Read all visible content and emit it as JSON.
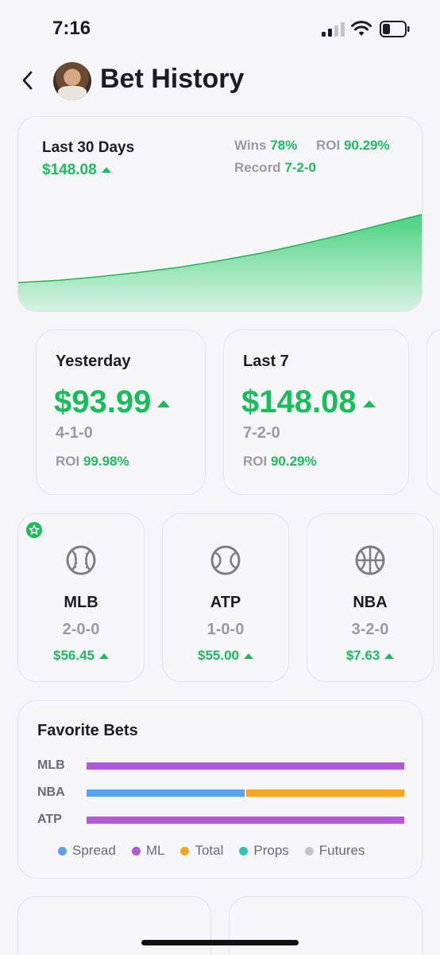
{
  "status_bar": {
    "time": "7:16"
  },
  "header": {
    "title": "Bet History"
  },
  "summary": {
    "label": "Last 30 Days",
    "amount": "$148.08",
    "wins_label": "Wins",
    "wins_value": "78%",
    "roi_label": "ROI",
    "roi_value": "90.29%",
    "record_label": "Record",
    "record_value": "7-2-0"
  },
  "period_cards": [
    {
      "title": "Yesterday",
      "amount": "$93.99",
      "record": "4-1-0",
      "roi_label": "ROI",
      "roi_value": "99.98%"
    },
    {
      "title": "Last 7",
      "amount": "$148.08",
      "record": "7-2-0",
      "roi_label": "ROI",
      "roi_value": "90.29%"
    }
  ],
  "sport_cards": [
    {
      "name": "MLB",
      "record": "2-0-0",
      "amount": "$56.45",
      "icon": "baseball-icon",
      "favorite": true
    },
    {
      "name": "ATP",
      "record": "1-0-0",
      "amount": "$55.00",
      "icon": "tennis-ball-icon",
      "favorite": false
    },
    {
      "name": "NBA",
      "record": "3-2-0",
      "amount": "$7.63",
      "icon": "basketball-icon",
      "favorite": false
    }
  ],
  "favorite_bets": {
    "title": "Favorite Bets",
    "rows": [
      {
        "label": "MLB",
        "segments": [
          {
            "type": "ML",
            "share": 1.0
          }
        ]
      },
      {
        "label": "NBA",
        "segments": [
          {
            "type": "Spread",
            "share": 0.5
          },
          {
            "type": "Total",
            "share": 0.5
          }
        ]
      },
      {
        "label": "ATP",
        "segments": [
          {
            "type": "ML",
            "share": 1.0
          }
        ]
      }
    ],
    "legend": [
      {
        "label": "Spread",
        "color": "#5aa2f0"
      },
      {
        "label": "ML",
        "color": "#b457d8"
      },
      {
        "label": "Total",
        "color": "#f5a623"
      },
      {
        "label": "Props",
        "color": "#2ec4b6"
      },
      {
        "label": "Futures",
        "color": "#c9c3c3"
      }
    ]
  },
  "colors": {
    "accent_green": "#1cbc5c",
    "muted": "#9a9aa0"
  },
  "chart_data": {
    "type": "area",
    "title": "",
    "xlabel": "",
    "ylabel": "",
    "x": [
      0,
      1,
      2,
      3,
      4,
      5,
      6,
      7,
      8,
      9,
      10
    ],
    "values": [
      0,
      3,
      8,
      14,
      21,
      30,
      40,
      52,
      65,
      79,
      93
    ],
    "grid": false
  }
}
